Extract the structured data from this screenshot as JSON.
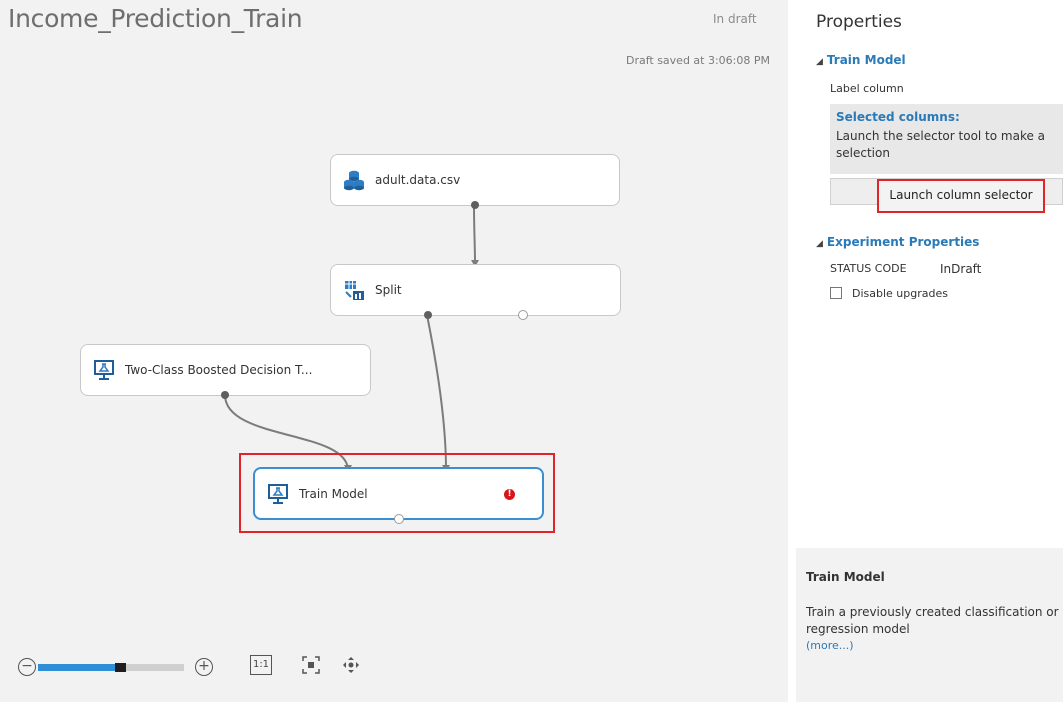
{
  "experiment": {
    "title": "Income_Prediction_Train",
    "state": "In draft",
    "saved_note": "Draft saved at 3:06:08 PM"
  },
  "modules": {
    "dataset": {
      "label": "adult.data.csv",
      "icon": "dataset-icon"
    },
    "split": {
      "label": "Split",
      "icon": "split-data-icon"
    },
    "boosted_tree": {
      "label": "Two-Class Boosted Decision T...",
      "icon": "model-icon"
    },
    "train_model": {
      "label": "Train Model",
      "icon": "train-model-icon",
      "error_badge": "!"
    }
  },
  "zoom_toolbar": {
    "zoom_out": "−",
    "zoom_in": "+",
    "actual_size": "1:1",
    "zoom_level": 0.6
  },
  "properties": {
    "title": "Properties",
    "train_model_section": {
      "heading": "Train Model",
      "label_column": "Label column",
      "selected_columns_title": "Selected columns:",
      "selected_columns_text": "Launch the selector tool to make a selection",
      "launch_button": "Launch column selector"
    },
    "experiment_section": {
      "heading": "Experiment Properties",
      "status_code_key": "STATUS CODE",
      "status_code_value": "InDraft",
      "disable_upgrades": "Disable upgrades",
      "disable_upgrades_checked": false
    },
    "help": {
      "title": "Train Model",
      "text": "Train a previously created classification or regression model",
      "more_link": "(more...)"
    }
  },
  "colors": {
    "accent": "#2a7ab8",
    "highlight": "#e0242a",
    "selected_border": "#3a8fd1",
    "error": "#d8151b"
  }
}
